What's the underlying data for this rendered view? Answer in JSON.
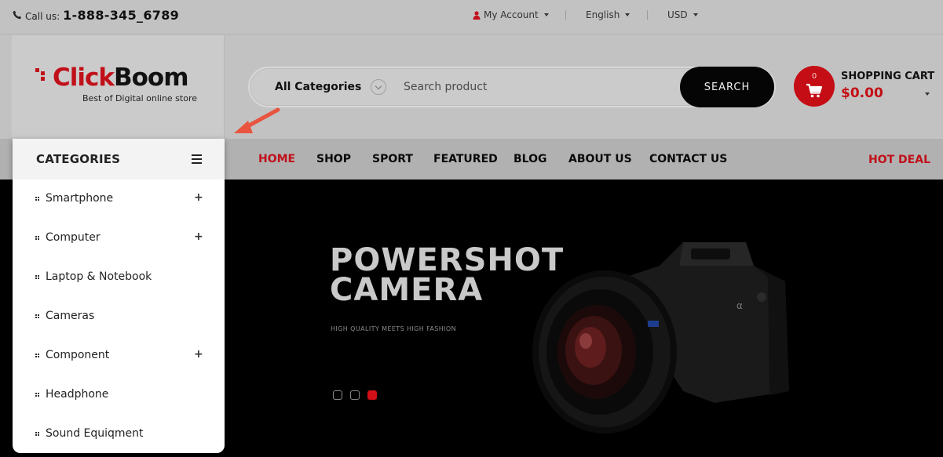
{
  "topbar": {
    "call_label": "Call us:",
    "phone": "1-888-345_6789",
    "account": "My Account",
    "language": "English",
    "currency": "USD"
  },
  "logo": {
    "brand_red": "Click",
    "brand_dark": "Boom",
    "tagline": "Best of Digital online store"
  },
  "search": {
    "category": "All Categories",
    "placeholder": "Search product",
    "button": "SEARCH"
  },
  "cart": {
    "count": "0",
    "title": "SHOPPING CART",
    "total": "$0.00"
  },
  "nav": {
    "items": [
      "HOME",
      "SHOP",
      "SPORT",
      "FEATURED",
      "BLOG",
      "ABOUT US",
      "CONTACT US"
    ],
    "hot_deal": "HOT DEAL"
  },
  "categories": {
    "title": "CATEGORIES",
    "items": [
      {
        "label": "Smartphone",
        "expand": "+"
      },
      {
        "label": "Computer",
        "expand": "+"
      },
      {
        "label": "Laptop & Notebook",
        "expand": ""
      },
      {
        "label": "Cameras",
        "expand": ""
      },
      {
        "label": "Component",
        "expand": "+"
      },
      {
        "label": "Headphone",
        "expand": ""
      },
      {
        "label": "Sound Equiqment",
        "expand": ""
      }
    ]
  },
  "hero": {
    "line1": "POWERSHOT",
    "line2": "CAMERA",
    "subtitle": "HIGH QUALITY MEETS HIGH FASHION",
    "active_slide": 3,
    "slide_count": 3
  },
  "colors": {
    "accent": "#c0101a",
    "dark": "#050505",
    "overlay_bg": "#c2c2c2"
  }
}
